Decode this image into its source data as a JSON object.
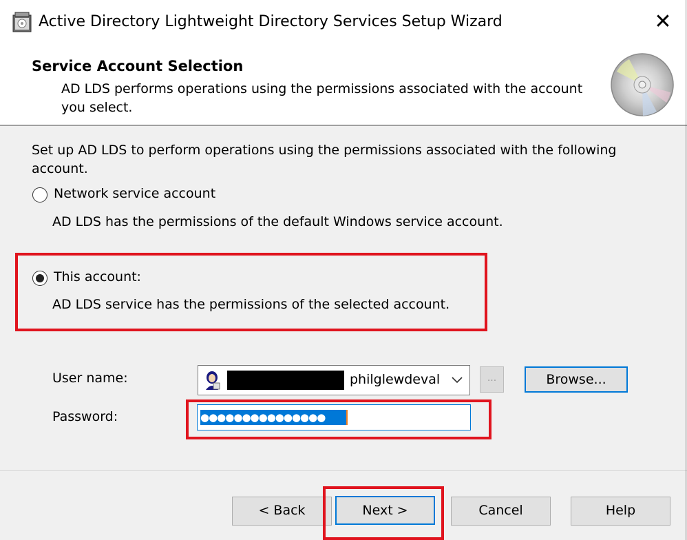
{
  "window": {
    "title": "Active Directory Lightweight Directory Services Setup Wizard",
    "close_glyph": "✕"
  },
  "header": {
    "title": "Service Account Selection",
    "subtitle": "AD LDS performs operations using the permissions associated with the account you select."
  },
  "content": {
    "intro": "Set up AD LDS to perform operations using the permissions associated with the following account.",
    "options": [
      {
        "label": "Network service account",
        "description": "AD LDS has the permissions of the default Windows service account.",
        "selected": false
      },
      {
        "label": "This account:",
        "description": "AD LDS service has the permissions of the selected account.",
        "selected": true
      }
    ],
    "user_name_label": "User name:",
    "user_name_value": "philglewdeval",
    "password_label": "Password:",
    "password_value": "●●●●●●●●●●●●●●●",
    "dots_button": "...",
    "browse_button": "Browse..."
  },
  "footer": {
    "back": "< Back",
    "next": "Next >",
    "cancel": "Cancel",
    "help": "Help"
  },
  "icons": [
    "wizard-app-icon",
    "close-icon",
    "cd-disc-icon",
    "user-account-icon",
    "chevron-down-icon"
  ],
  "colors": {
    "accent": "#0078d7",
    "highlight": "#e0141e",
    "dialog_bg": "#f0f0f0"
  }
}
